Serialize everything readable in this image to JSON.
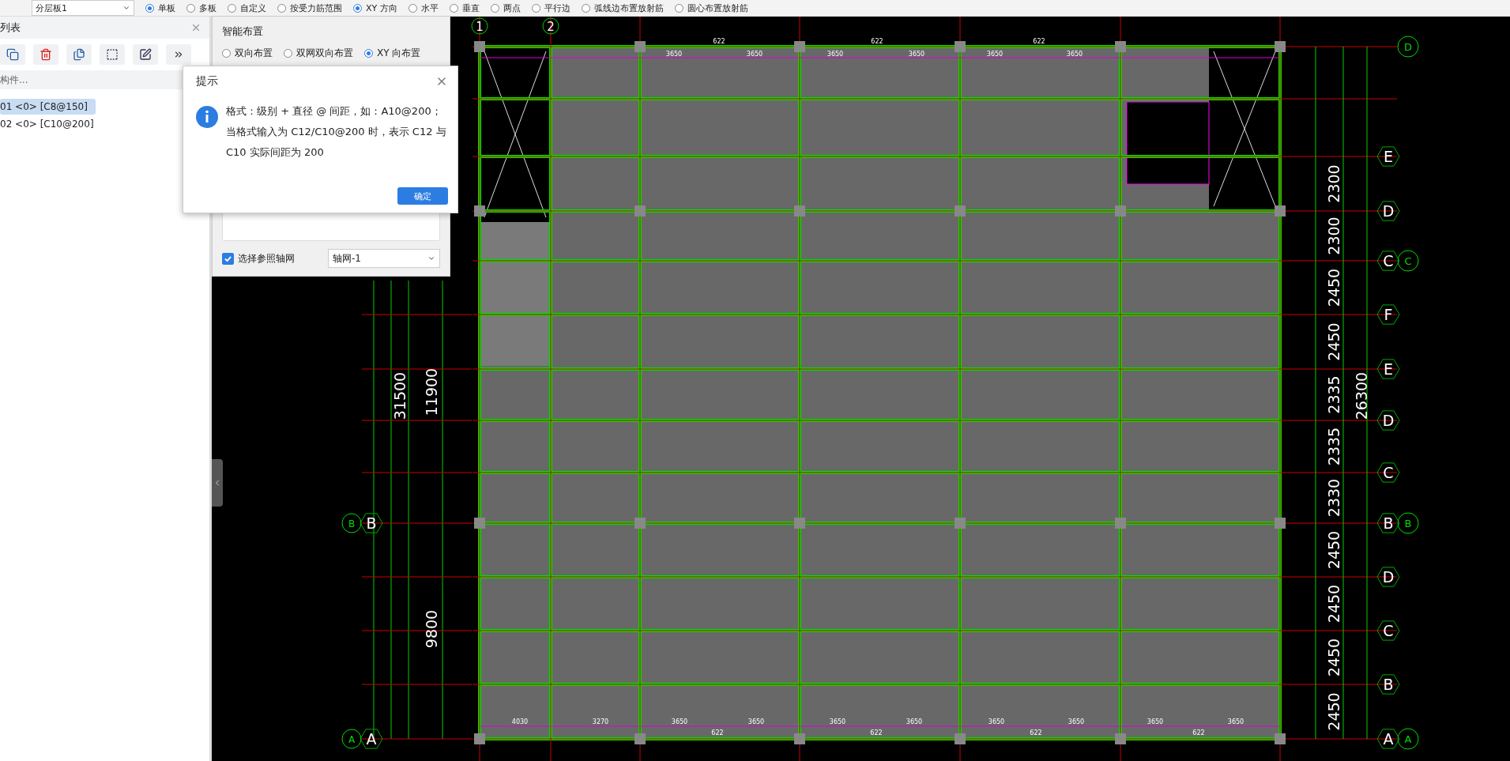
{
  "toolbar": {
    "layer_dropdown": "分层板1",
    "mode_options": [
      {
        "label": "单板",
        "selected": true
      },
      {
        "label": "多板",
        "selected": false
      },
      {
        "label": "自定义",
        "selected": false
      },
      {
        "label": "按受力筋范围",
        "selected": false
      }
    ],
    "direction_options": [
      {
        "label": "XY 方向",
        "selected": true
      },
      {
        "label": "水平",
        "selected": false
      },
      {
        "label": "垂直",
        "selected": false
      },
      {
        "label": "两点",
        "selected": false
      },
      {
        "label": "平行边",
        "selected": false
      },
      {
        "label": "弧线边布置放射筋",
        "selected": false
      },
      {
        "label": "圆心布置放射筋",
        "selected": false
      }
    ]
  },
  "component_list": {
    "title": "列表",
    "search": {
      "placeholder": "构件..."
    },
    "items": [
      {
        "label": "01 <0> [C8@150]",
        "selected": true
      },
      {
        "label": "02 <0> [C10@200]",
        "selected": false
      }
    ]
  },
  "smart_layout": {
    "title": "智能布置",
    "options": [
      {
        "label": "双向布置",
        "selected": false
      },
      {
        "label": "双网双向布置",
        "selected": false
      },
      {
        "label": "XY 向布置",
        "selected": true
      }
    ],
    "reference_grid": {
      "label": "选择参照轴网",
      "checked": true,
      "value": "轴网-1"
    }
  },
  "dialog": {
    "title": "提示",
    "message": "格式：级别 + 直径 @ 间距，如：A10@200；当格式输入为 C12/C10@200 时，表示 C12 与 C10 实际间距为 200",
    "button": "确定"
  },
  "drawing": {
    "top_axes": [
      "1",
      "2"
    ],
    "top_dims": [
      "622",
      "622",
      "622"
    ],
    "span_dims": [
      "3650",
      "3650",
      "3650",
      "3650",
      "3650",
      "3650"
    ],
    "bottom_dims": [
      "4030",
      "3270",
      "3650",
      "3650",
      "3650",
      "3650",
      "3650",
      "3650",
      "3650",
      "3650"
    ],
    "bottom_small_dims": [
      "622",
      "622",
      "622",
      "622"
    ],
    "right_axes": [
      "E",
      "D",
      "C",
      "F",
      "E",
      "D",
      "C",
      "B",
      "D",
      "C",
      "B",
      "A"
    ],
    "right_dims": [
      "2300",
      "2300",
      "2450",
      "2450",
      "2335",
      "2335",
      "2330",
      "2450",
      "2450",
      "2450",
      "2450"
    ],
    "right_total": "26300",
    "right_circle_axes": [
      "D",
      "C",
      "B",
      "A"
    ],
    "left_axes": [
      "B",
      "A"
    ],
    "left_circle_axes": [
      "B",
      "A"
    ],
    "left_dims": [
      "31500",
      "11900",
      "9800"
    ]
  }
}
